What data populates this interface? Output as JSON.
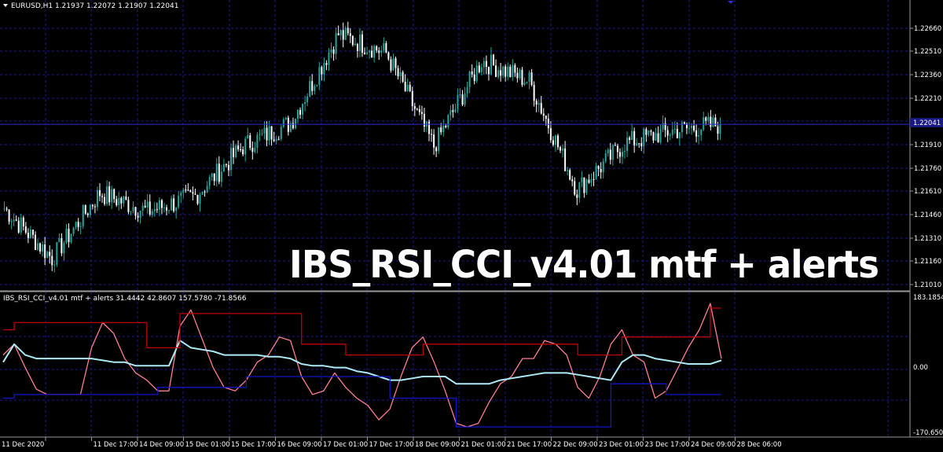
{
  "main": {
    "header": "EURUSD,H1  1.21937 1.22072 1.21907 1.22041",
    "price_labels": [
      "1.22660",
      "1.22510",
      "1.22360",
      "1.22210",
      "1.22060",
      "1.21910",
      "1.21760",
      "1.21610",
      "1.21460",
      "1.21310",
      "1.21160",
      "1.21010"
    ],
    "current_price": "1.22041",
    "overlay_title": "IBS_RSI_CCI_v4.01 mtf + alerts",
    "colors": {
      "bull": "#26a69a",
      "bear": "#ffffff",
      "grid": "#1c1c8a",
      "bid_line": "#2b2bd0"
    }
  },
  "indicator": {
    "header": "IBS_RSI_CCI_v4.01 mtf + alerts 31.4442 42.8607 157.5780 -71.8566",
    "labels": [
      "183.1854",
      "0.00",
      "-170.6508"
    ],
    "colors": {
      "pink": "#ff7f92",
      "cyan": "#aeeaf5",
      "red": "#c00000",
      "blue": "#1414c8"
    }
  },
  "time_labels": [
    "11 Dec 2020",
    "11 Dec 17:00",
    "14 Dec 09:00",
    "15 Dec 01:00",
    "15 Dec 17:00",
    "16 Dec 09:00",
    "17 Dec 01:00",
    "17 Dec 17:00",
    "18 Dec 09:00",
    "21 Dec 01:00",
    "21 Dec 17:00",
    "22 Dec 09:00",
    "23 Dec 01:00",
    "23 Dec 17:00",
    "24 Dec 09:00",
    "28 Dec 06:00"
  ],
  "chart_data": [
    {
      "type": "candlestick",
      "title": "EURUSD,H1",
      "ylim": [
        1.2101,
        1.2276
      ],
      "grid": true,
      "key_points": [
        {
          "x": "11 Dec 2020",
          "y": 1.215
        },
        {
          "x": "11 Dec 17:00",
          "y": 1.2118
        },
        {
          "x": "14 Dec 09:00",
          "y": 1.216
        },
        {
          "x": "15 Dec 01:00",
          "y": 1.2148
        },
        {
          "x": "15 Dec 17:00",
          "y": 1.2158
        },
        {
          "x": "16 Dec 09:00",
          "y": 1.219
        },
        {
          "x": "17 Dec 01:00",
          "y": 1.2205
        },
        {
          "x": "17 Dec 17:00",
          "y": 1.2262
        },
        {
          "x": "18 Dec 09:00",
          "y": 1.225
        },
        {
          "x": "21 Dec 01:00",
          "y": 1.219
        },
        {
          "x": "21 Dec 17:00",
          "y": 1.2245
        },
        {
          "x": "22 Dec 09:00",
          "y": 1.2232
        },
        {
          "x": "23 Dec 01:00",
          "y": 1.2162
        },
        {
          "x": "23 Dec 17:00",
          "y": 1.2192
        },
        {
          "x": "24 Dec 09:00",
          "y": 1.22
        },
        {
          "x": "28 Dec 06:00",
          "y": 1.2204
        }
      ]
    },
    {
      "type": "line",
      "title": "IBS_RSI_CCI_v4.01 mtf + alerts",
      "ylim": [
        -170.6508,
        183.1854
      ],
      "series": [
        {
          "color": "#ff7f92",
          "values": [
            40,
            70,
            5,
            -55,
            -70,
            -70,
            -70,
            -70,
            60,
            130,
            100,
            30,
            -10,
            -30,
            -60,
            -60,
            120,
            165,
            85,
            5,
            -50,
            -60,
            -30,
            20,
            40,
            90,
            80,
            -20,
            -70,
            -60,
            -10,
            -50,
            -80,
            -100,
            -140,
            -110,
            -20,
            60,
            90,
            20,
            -60,
            -150,
            -160,
            -150,
            -90,
            -40,
            -20,
            30,
            30,
            80,
            70,
            40,
            -50,
            -80,
            -20,
            70,
            110,
            40,
            20,
            -80,
            -60,
            0,
            60,
            110,
            183,
            30
          ]
        },
        {
          "color": "#aeeaf5",
          "values": [
            20,
            70,
            40,
            30,
            30,
            30,
            30,
            30,
            30,
            25,
            20,
            20,
            10,
            10,
            10,
            10,
            80,
            60,
            55,
            50,
            40,
            40,
            40,
            40,
            35,
            35,
            30,
            15,
            10,
            10,
            5,
            5,
            -5,
            -10,
            -20,
            -30,
            -30,
            -25,
            -20,
            -20,
            -20,
            -40,
            -40,
            -40,
            -40,
            -30,
            -25,
            -20,
            -15,
            -10,
            -10,
            -10,
            -15,
            -20,
            -25,
            -30,
            20,
            40,
            40,
            30,
            25,
            20,
            15,
            15,
            15,
            25
          ]
        },
        {
          "color": "#c00000",
          "values": [
            110,
            130,
            130,
            130,
            130,
            130,
            130,
            130,
            130,
            130,
            130,
            130,
            130,
            60,
            60,
            60,
            155,
            155,
            155,
            155,
            155,
            155,
            155,
            155,
            155,
            155,
            155,
            70,
            70,
            70,
            70,
            40,
            40,
            40,
            40,
            40,
            40,
            40,
            70,
            70,
            70,
            70,
            70,
            70,
            70,
            70,
            70,
            70,
            70,
            70,
            70,
            70,
            40,
            40,
            40,
            40,
            90,
            90,
            90,
            90,
            90,
            90,
            90,
            90,
            170,
            170
          ]
        },
        {
          "color": "#1414c8",
          "values": [
            -80,
            -70,
            -70,
            -70,
            -70,
            -70,
            -70,
            -70,
            -70,
            -70,
            -70,
            -70,
            -70,
            -70,
            -50,
            -50,
            -50,
            -50,
            -50,
            -50,
            -50,
            -50,
            -20,
            -20,
            -20,
            -20,
            -20,
            -20,
            -20,
            -20,
            -20,
            -20,
            -20,
            -20,
            -20,
            -80,
            -80,
            -80,
            -80,
            -80,
            -80,
            -160,
            -160,
            -160,
            -160,
            -160,
            -160,
            -160,
            -160,
            -160,
            -160,
            -160,
            -160,
            -160,
            -160,
            -40,
            -40,
            -40,
            -40,
            -40,
            -70,
            -70,
            -70,
            -70,
            -70,
            -70
          ]
        }
      ]
    }
  ]
}
